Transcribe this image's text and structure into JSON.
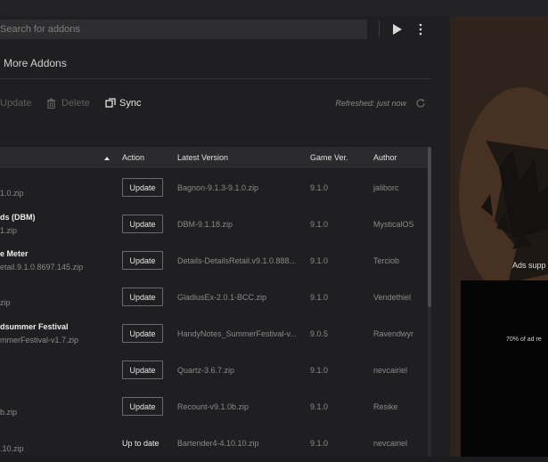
{
  "search": {
    "placeholder": "Search for addons"
  },
  "section_title": "More Addons",
  "toolbar": {
    "update_label": "Update",
    "delete_label": "Delete",
    "sync_label": "Sync",
    "refreshed_label": "Refreshed: just now"
  },
  "table": {
    "columns": [
      "Action",
      "Latest Version",
      "Game Ver.",
      "Author"
    ],
    "rows": [
      {
        "name": "",
        "file": "1.0.zip",
        "action": "Update",
        "latest": "Bagnon-9.1.3-9.1.0.zip",
        "game_ver": "9.1.0",
        "author": "jaliborc"
      },
      {
        "name": "ds (DBM)",
        "file": "1.zip",
        "action": "Update",
        "latest": "DBM-9.1.18.zip",
        "game_ver": "9.1.0",
        "author": "MysticalOS"
      },
      {
        "name": "e Meter",
        "file": "etail.9.1.0.8697.145.zip",
        "action": "Update",
        "latest": "Details-DetailsRetail.v9.1.0.888...",
        "game_ver": "9.1.0",
        "author": "Terciob"
      },
      {
        "name": "",
        "file": "zip",
        "action": "Update",
        "latest": "GladiusEx-2.0.1-BCC.zip",
        "game_ver": "9.1.0",
        "author": "Vendethiel"
      },
      {
        "name": "dsummer Festival",
        "file": "mmerFestival-v1.7.zip",
        "action": "Update",
        "latest": "HandyNotes_SummerFestival-v...",
        "game_ver": "9.0.5",
        "author": "Ravendwyr"
      },
      {
        "name": "",
        "file": "",
        "action": "Update",
        "latest": "Quartz-3.6.7.zip",
        "game_ver": "9.1.0",
        "author": "nevcairiel"
      },
      {
        "name": "",
        "file": "b.zip",
        "action": "Update",
        "latest": "Recount-v9.1.0b.zip",
        "game_ver": "9.1.0",
        "author": "Resike"
      },
      {
        "name": "",
        "file": ".10.zip",
        "action": "Up to date",
        "latest": "Bartender4-4.10.10.zip",
        "game_ver": "9.1.0",
        "author": "nevcairiel"
      }
    ]
  },
  "side_panel": {
    "ads_label": "Ads supp",
    "ad_text": "70% of ad re"
  },
  "colors": {
    "background": "#1f1f21",
    "header_bg": "#2b2b2d",
    "text": "#ededed",
    "muted": "#8a8a8a",
    "disabled": "#5f5f5f"
  },
  "icons": {
    "play": "play-icon",
    "more": "more-vertical-icon",
    "trash": "trash-icon",
    "sync": "sync-icon",
    "refresh": "refresh-icon",
    "sort": "sort-up-icon"
  }
}
